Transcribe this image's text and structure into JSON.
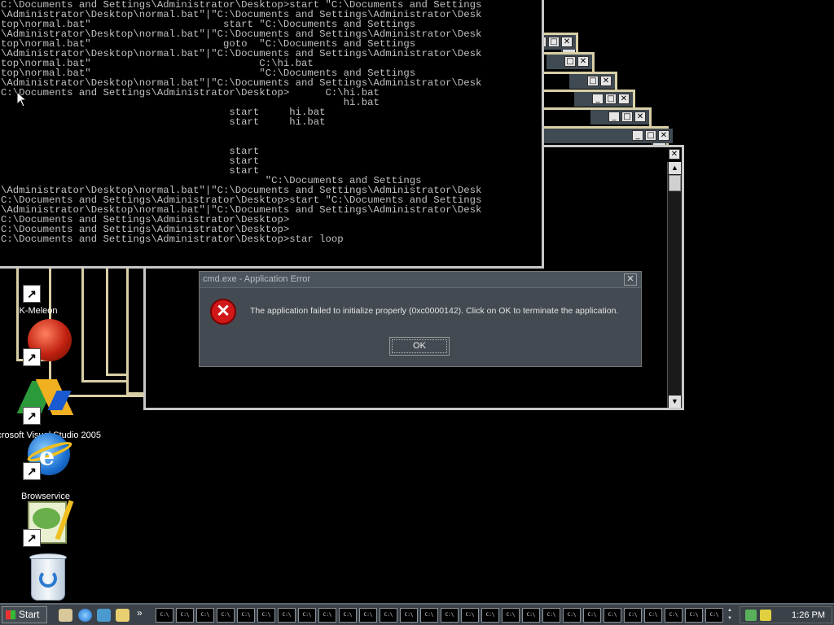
{
  "console": {
    "lines": [
      "C:\\Documents and Settings\\Administrator\\Desktop>start \"C:\\Documents and Settings",
      "\\Administrator\\Desktop\\normal.bat\"|\"C:\\Documents and Settings\\Administrator\\Desk",
      "top\\normal.bat\"                      start \"C:\\Documents and Settings",
      "\\Administrator\\Desktop\\normal.bat\"|\"C:\\Documents and Settings\\Administrator\\Desk",
      "top\\normal.bat\"                      goto  \"C:\\Documents and Settings",
      "\\Administrator\\Desktop\\normal.bat\"|\"C:\\Documents and Settings\\Administrator\\Desk",
      "top\\normal.bat\"                            C:\\hi.bat",
      "top\\normal.bat\"                            \"C:\\Documents and Settings",
      "\\Administrator\\Desktop\\normal.bat\"|\"C:\\Documents and Settings\\Administrator\\Desk",
      "C:\\Documents and Settings\\Administrator\\Desktop>      C:\\hi.bat",
      "                                                         hi.bat",
      "                                      start     hi.bat",
      "                                      start     hi.bat",
      "",
      "",
      "                                      start",
      "                                      start",
      "                                      start",
      "                                            \"C:\\Documents and Settings",
      "\\Administrator\\Desktop\\normal.bat\"|\"C:\\Documents and Settings\\Administrator\\Desk",
      "C:\\Documents and Settings\\Administrator\\Desktop>start \"C:\\Documents and Settings",
      "\\Administrator\\Desktop\\normal.bat\"|\"C:\\Documents and Settings\\Administrator\\Desk",
      "C:\\Documents and Settings\\Administrator\\Desktop>",
      "C:\\Documents and Settings\\Administrator\\Desktop>",
      "C:\\Documents and Settings\\Administrator\\Desktop>star loop"
    ]
  },
  "window_controls": {
    "minimize": "_",
    "maximize": "□",
    "close": "✕",
    "scroll_up": "▲",
    "scroll_down": "▼"
  },
  "desktop_icons": [
    {
      "label": "K-Meleon",
      "icon": "k-meleon-icon",
      "color": "#c0301a"
    },
    {
      "label": "",
      "icon": "k-meleon-ball-icon",
      "color": "#b02010"
    },
    {
      "label": "crosoft Visual Studio 2005",
      "icon": "visual-studio-icon",
      "color": "#2a7a2a"
    },
    {
      "label": "Browservice",
      "icon": "internet-explorer-icon",
      "color": "#1a6fd0"
    },
    {
      "label": "",
      "icon": "notepad-plus-icon",
      "color": "#6ab04a"
    },
    {
      "label": "",
      "icon": "recycle-bin-icon",
      "color": "#b8c8d8"
    }
  ],
  "shortcut_arrow": "↗",
  "dialog": {
    "title": "cmd.exe - Application Error",
    "close": "✕",
    "error_glyph": "✕",
    "message": "The application failed to initialize properly (0xc0000142). Click on OK to terminate the application.",
    "ok_label": "OK"
  },
  "taskbar": {
    "start_label": "Start",
    "chevron": "»",
    "task_label": "C:\\",
    "task_count": 28,
    "tray_up": "▲",
    "tray_down": "▼",
    "clock": "1:26 PM"
  },
  "colors": {
    "console_text": "#c0c0c0",
    "frame": "#d8cfa6",
    "dialog_bg": "#434a51",
    "taskbar": "#3a4148",
    "error_red": "#d01818"
  }
}
